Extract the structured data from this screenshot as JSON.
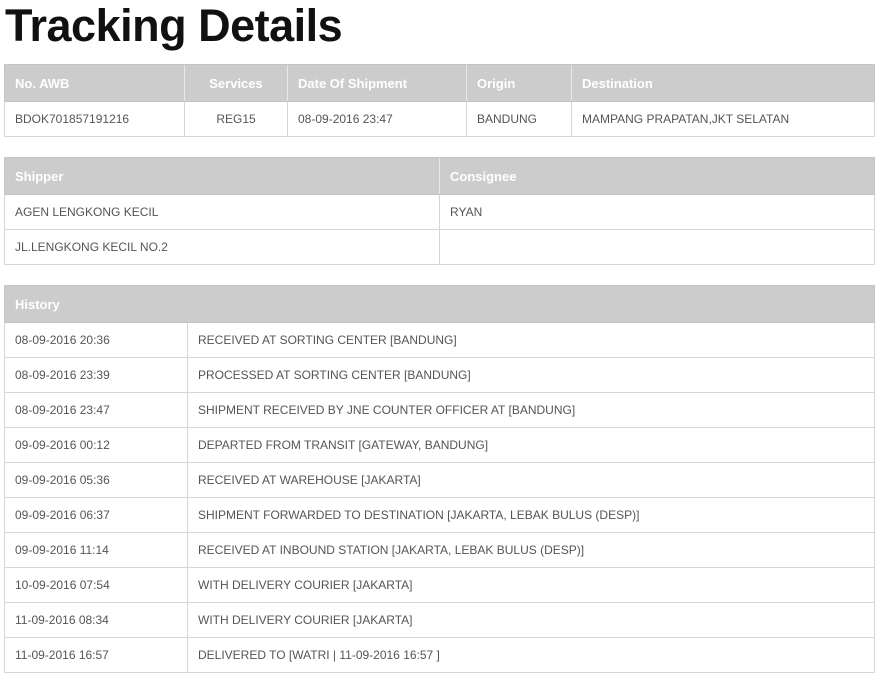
{
  "page_title": "Tracking Details",
  "shipment": {
    "headers": {
      "awb": "No. AWB",
      "services": "Services",
      "date": "Date Of Shipment",
      "origin": "Origin",
      "destination": "Destination"
    },
    "awb": "BDOK701857191216",
    "services": "REG15",
    "date": "08-09-2016 23:47",
    "origin": "BANDUNG",
    "destination": "MAMPANG PRAPATAN,JKT SELATAN"
  },
  "parties": {
    "headers": {
      "shipper": "Shipper",
      "consignee": "Consignee"
    },
    "shipper_name": "AGEN LENGKONG KECIL",
    "shipper_address": "JL.LENGKONG KECIL NO.2",
    "consignee_name": "RYAN",
    "consignee_address": ""
  },
  "history": {
    "header": "History",
    "rows": [
      {
        "datetime": "08-09-2016 20:36",
        "status": "RECEIVED AT SORTING CENTER [BANDUNG]"
      },
      {
        "datetime": "08-09-2016 23:39",
        "status": "PROCESSED AT SORTING CENTER [BANDUNG]"
      },
      {
        "datetime": "08-09-2016 23:47",
        "status": "SHIPMENT RECEIVED BY JNE COUNTER OFFICER AT [BANDUNG]"
      },
      {
        "datetime": "09-09-2016 00:12",
        "status": "DEPARTED FROM TRANSIT [GATEWAY, BANDUNG]"
      },
      {
        "datetime": "09-09-2016 05:36",
        "status": "RECEIVED AT WAREHOUSE [JAKARTA]"
      },
      {
        "datetime": "09-09-2016 06:37",
        "status": "SHIPMENT FORWARDED TO DESTINATION [JAKARTA, LEBAK BULUS (DESP)]"
      },
      {
        "datetime": "09-09-2016 11:14",
        "status": "RECEIVED AT INBOUND STATION [JAKARTA, LEBAK BULUS (DESP)]"
      },
      {
        "datetime": "10-09-2016 07:54",
        "status": "WITH DELIVERY COURIER [JAKARTA]"
      },
      {
        "datetime": "11-09-2016 08:34",
        "status": "WITH DELIVERY COURIER [JAKARTA]"
      },
      {
        "datetime": "11-09-2016 16:57",
        "status": "DELIVERED TO [WATRI | 11-09-2016 16:57 ]"
      }
    ]
  },
  "colors": {
    "header_bg": "#cccccc",
    "header_text": "#ffffff",
    "cell_text": "#555555",
    "border": "#d7d7d7",
    "title": "#111111"
  }
}
